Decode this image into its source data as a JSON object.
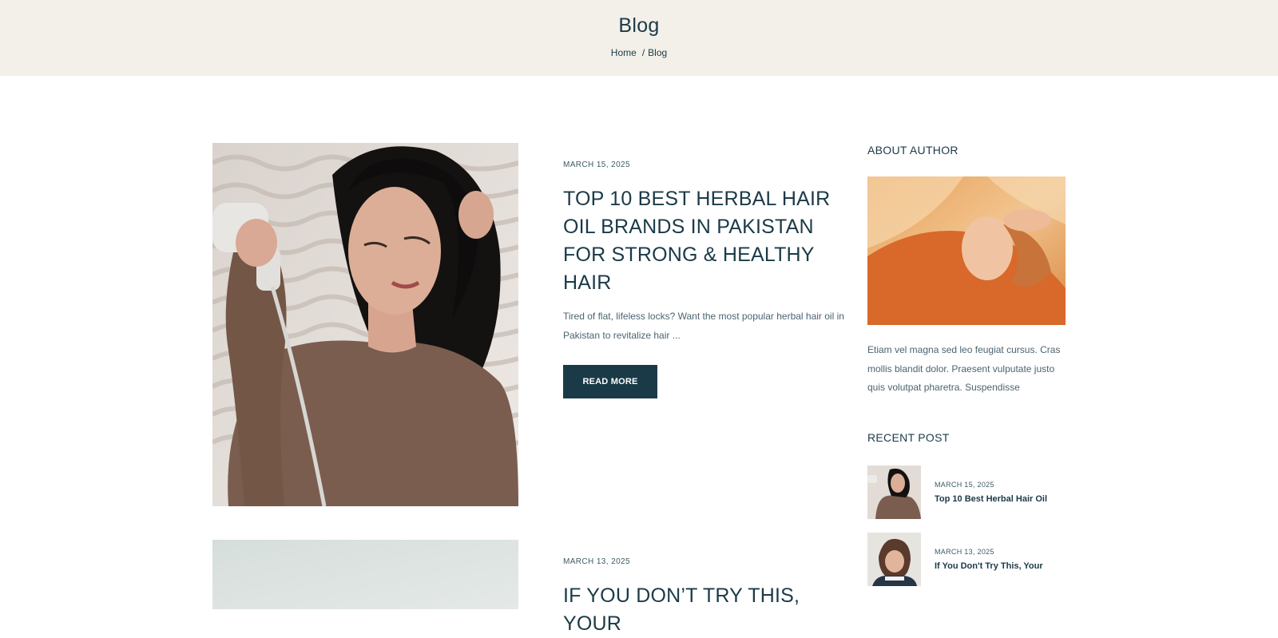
{
  "header": {
    "title": "Blog",
    "breadcrumb": {
      "home": "Home",
      "separator": "/",
      "current": "Blog"
    }
  },
  "posts": [
    {
      "date": "MARCH 15, 2025",
      "title": "TOP 10 BEST HERBAL HAIR OIL BRANDS IN PAKISTAN FOR STRONG & HEALTHY HAIR",
      "excerpt": "Tired of flat, lifeless locks? Want the most popular herbal hair oil in Pakistan to revitalize hair ...",
      "button": "READ MORE"
    },
    {
      "date": "MARCH 13, 2025",
      "title": "IF YOU DON’T TRY THIS, YOUR"
    }
  ],
  "sidebar": {
    "about_title": "ABOUT AUTHOR",
    "about_text": "Etiam vel magna sed leo feugiat cursus. Cras mollis blandit dolor. Praesent vulputate justo quis volutpat pharetra. Suspendisse",
    "recent_title": "RECENT POST",
    "recent": [
      {
        "date": "MARCH 15, 2025",
        "title": "Top 10 Best Herbal Hair Oil"
      },
      {
        "date": "MARCH 13, 2025",
        "title": "If You Don't Try This, Your"
      }
    ]
  },
  "colors": {
    "header_bg": "#f3f0e9",
    "primary": "#1b3a47",
    "button_bg": "#1b3a47",
    "button_text": "#ffffff"
  }
}
